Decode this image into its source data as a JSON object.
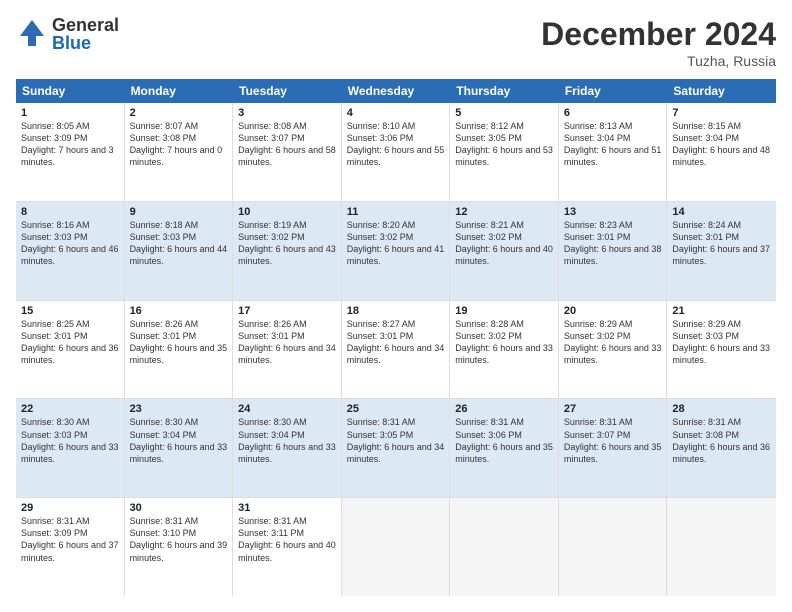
{
  "logo": {
    "general": "General",
    "blue": "Blue"
  },
  "header": {
    "month": "December 2024",
    "location": "Tuzha, Russia"
  },
  "weekdays": [
    "Sunday",
    "Monday",
    "Tuesday",
    "Wednesday",
    "Thursday",
    "Friday",
    "Saturday"
  ],
  "weeks": [
    [
      {
        "day": "1",
        "sunrise": "8:05 AM",
        "sunset": "3:09 PM",
        "daylight": "7 hours and 3 minutes."
      },
      {
        "day": "2",
        "sunrise": "8:07 AM",
        "sunset": "3:08 PM",
        "daylight": "7 hours and 0 minutes."
      },
      {
        "day": "3",
        "sunrise": "8:08 AM",
        "sunset": "3:07 PM",
        "daylight": "6 hours and 58 minutes."
      },
      {
        "day": "4",
        "sunrise": "8:10 AM",
        "sunset": "3:06 PM",
        "daylight": "6 hours and 55 minutes."
      },
      {
        "day": "5",
        "sunrise": "8:12 AM",
        "sunset": "3:05 PM",
        "daylight": "6 hours and 53 minutes."
      },
      {
        "day": "6",
        "sunrise": "8:13 AM",
        "sunset": "3:04 PM",
        "daylight": "6 hours and 51 minutes."
      },
      {
        "day": "7",
        "sunrise": "8:15 AM",
        "sunset": "3:04 PM",
        "daylight": "6 hours and 48 minutes."
      }
    ],
    [
      {
        "day": "8",
        "sunrise": "8:16 AM",
        "sunset": "3:03 PM",
        "daylight": "6 hours and 46 minutes."
      },
      {
        "day": "9",
        "sunrise": "8:18 AM",
        "sunset": "3:03 PM",
        "daylight": "6 hours and 44 minutes."
      },
      {
        "day": "10",
        "sunrise": "8:19 AM",
        "sunset": "3:02 PM",
        "daylight": "6 hours and 43 minutes."
      },
      {
        "day": "11",
        "sunrise": "8:20 AM",
        "sunset": "3:02 PM",
        "daylight": "6 hours and 41 minutes."
      },
      {
        "day": "12",
        "sunrise": "8:21 AM",
        "sunset": "3:02 PM",
        "daylight": "6 hours and 40 minutes."
      },
      {
        "day": "13",
        "sunrise": "8:23 AM",
        "sunset": "3:01 PM",
        "daylight": "6 hours and 38 minutes."
      },
      {
        "day": "14",
        "sunrise": "8:24 AM",
        "sunset": "3:01 PM",
        "daylight": "6 hours and 37 minutes."
      }
    ],
    [
      {
        "day": "15",
        "sunrise": "8:25 AM",
        "sunset": "3:01 PM",
        "daylight": "6 hours and 36 minutes."
      },
      {
        "day": "16",
        "sunrise": "8:26 AM",
        "sunset": "3:01 PM",
        "daylight": "6 hours and 35 minutes."
      },
      {
        "day": "17",
        "sunrise": "8:26 AM",
        "sunset": "3:01 PM",
        "daylight": "6 hours and 34 minutes."
      },
      {
        "day": "18",
        "sunrise": "8:27 AM",
        "sunset": "3:01 PM",
        "daylight": "6 hours and 34 minutes."
      },
      {
        "day": "19",
        "sunrise": "8:28 AM",
        "sunset": "3:02 PM",
        "daylight": "6 hours and 33 minutes."
      },
      {
        "day": "20",
        "sunrise": "8:29 AM",
        "sunset": "3:02 PM",
        "daylight": "6 hours and 33 minutes."
      },
      {
        "day": "21",
        "sunrise": "8:29 AM",
        "sunset": "3:03 PM",
        "daylight": "6 hours and 33 minutes."
      }
    ],
    [
      {
        "day": "22",
        "sunrise": "8:30 AM",
        "sunset": "3:03 PM",
        "daylight": "6 hours and 33 minutes."
      },
      {
        "day": "23",
        "sunrise": "8:30 AM",
        "sunset": "3:04 PM",
        "daylight": "6 hours and 33 minutes."
      },
      {
        "day": "24",
        "sunrise": "8:30 AM",
        "sunset": "3:04 PM",
        "daylight": "6 hours and 33 minutes."
      },
      {
        "day": "25",
        "sunrise": "8:31 AM",
        "sunset": "3:05 PM",
        "daylight": "6 hours and 34 minutes."
      },
      {
        "day": "26",
        "sunrise": "8:31 AM",
        "sunset": "3:06 PM",
        "daylight": "6 hours and 35 minutes."
      },
      {
        "day": "27",
        "sunrise": "8:31 AM",
        "sunset": "3:07 PM",
        "daylight": "6 hours and 35 minutes."
      },
      {
        "day": "28",
        "sunrise": "8:31 AM",
        "sunset": "3:08 PM",
        "daylight": "6 hours and 36 minutes."
      }
    ],
    [
      {
        "day": "29",
        "sunrise": "8:31 AM",
        "sunset": "3:09 PM",
        "daylight": "6 hours and 37 minutes."
      },
      {
        "day": "30",
        "sunrise": "8:31 AM",
        "sunset": "3:10 PM",
        "daylight": "6 hours and 39 minutes."
      },
      {
        "day": "31",
        "sunrise": "8:31 AM",
        "sunset": "3:11 PM",
        "daylight": "6 hours and 40 minutes."
      },
      null,
      null,
      null,
      null
    ]
  ]
}
